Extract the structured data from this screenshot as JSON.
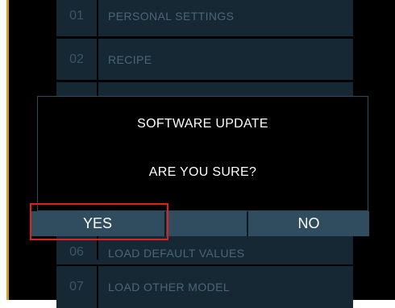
{
  "menu": {
    "items": [
      {
        "num": "01",
        "label": "PERSONAL SETTINGS"
      },
      {
        "num": "02",
        "label": "RECIPE"
      },
      {
        "num": "06",
        "label": "LOAD DEFAULT VALUES"
      },
      {
        "num": "07",
        "label": "LOAD OTHER MODEL"
      }
    ]
  },
  "dialog": {
    "title": "SOFTWARE UPDATE",
    "message": "ARE YOU SURE?",
    "yes_label": "YES",
    "no_label": "NO"
  },
  "colors": {
    "screen_bg": "#000000",
    "menu_bg": "#162833",
    "button_bg": "#2f4d5f",
    "highlight": "#e02020"
  }
}
